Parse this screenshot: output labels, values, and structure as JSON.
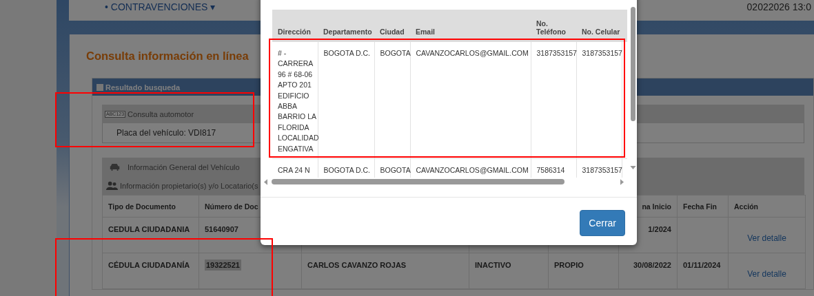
{
  "nav": {
    "menu_item": "• CONTRAVENCIONES ▾",
    "date": "02022026 13:0"
  },
  "page_title": "Consulta información en línea",
  "result_panel": {
    "title": "Resultado busqueda",
    "sections": [
      {
        "kind": "plate",
        "title": "Consulta automotor",
        "icon_text": "ABC123",
        "body": "Placa del vehículo: VDI817"
      },
      {
        "kind": "vehicle",
        "title": "Información General del Vehículo"
      },
      {
        "kind": "owners",
        "title": "Información propietario(s) y/o Locatario(s"
      }
    ]
  },
  "owners_table": {
    "columns": [
      "Tipo de Documento",
      "Número de Doc",
      null,
      null,
      null,
      "na Inicio",
      "Fecha Fin",
      "Acción"
    ],
    "rows": [
      {
        "cells": [
          {
            "text": "CEDULA CIUDADANIA",
            "highlighted": false
          },
          {
            "text": "51640907",
            "highlighted": false
          },
          null,
          null,
          null,
          {
            "text": "1/2024",
            "highlighted": false
          },
          null
        ],
        "action": "Ver detalle"
      },
      {
        "cells": [
          {
            "text": "CÉDULA CIUDADANÍA",
            "highlighted": false
          },
          {
            "text": "19322521",
            "highlighted": true
          },
          {
            "text": "CARLOS CAVANZO ROJAS",
            "highlighted": false
          },
          {
            "text": "INACTIVO",
            "highlighted": false
          },
          {
            "text": "PROPIO",
            "highlighted": false
          },
          {
            "text": "30/08/2022",
            "highlighted": false
          },
          {
            "text": "01/11/2024",
            "highlighted": false
          }
        ],
        "action": "Ver detalle"
      }
    ]
  },
  "modal": {
    "columns": [
      "Dirección",
      "Departamento",
      "Ciudad",
      "Email",
      "No. Teléfono",
      "No. Celular"
    ],
    "rows": [
      [
        "# - CARRERA 96 # 68-06 APTO 201 EDIFICIO ABBA BARRIO LA FLORIDA LOCALIDAD ENGATIVA",
        "BOGOTA D.C.",
        "BOGOTA",
        "CAVANZOCARLOS@GMAIL.COM",
        "3187353157",
        "3187353157"
      ],
      [
        "CRA 24 N",
        "BOGOTA D.C.",
        "BOGOTA",
        "CAVANZOCARLOS@GMAIL.COM",
        "7586314",
        "3187353157"
      ]
    ],
    "close_button": "Cerrar"
  }
}
